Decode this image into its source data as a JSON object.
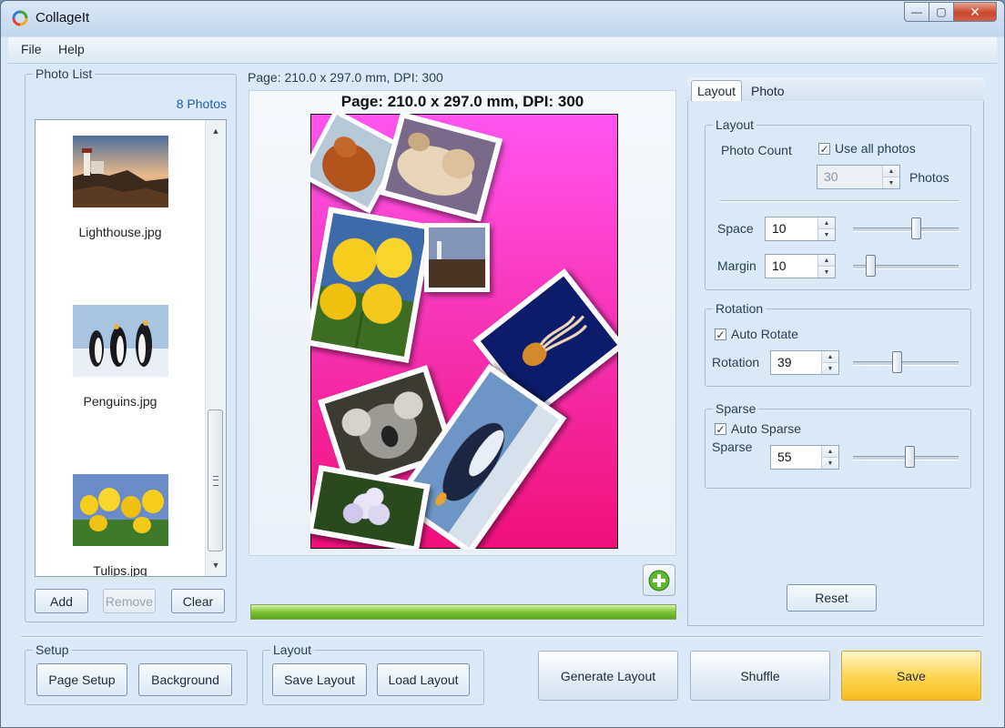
{
  "window": {
    "title": "CollageIt",
    "minimize": "—",
    "maximize": "▢",
    "close": "✕"
  },
  "menu": {
    "file": "File",
    "help": "Help"
  },
  "photo_list": {
    "title": "Photo List",
    "count": "8 Photos",
    "items": [
      {
        "name": "Lighthouse.jpg",
        "thumb": "lighthouse"
      },
      {
        "name": "Penguins.jpg",
        "thumb": "penguins"
      },
      {
        "name": "Tulips.jpg",
        "thumb": "tulips"
      }
    ],
    "add": "Add",
    "remove": "Remove",
    "clear": "Clear"
  },
  "preview": {
    "page_info": "Page: 210.0 x 297.0 mm, DPI: 300",
    "page_title": "Page: 210.0 x 297.0 mm, DPI: 300",
    "background_colors": [
      "#ff55ee",
      "#f0107a"
    ],
    "progress": 1.0
  },
  "tabs": {
    "layout": "Layout",
    "photo": "Photo",
    "active": "Layout"
  },
  "layout_group": {
    "title": "Layout",
    "photo_count_label": "Photo Count",
    "use_all_label": "Use all photos",
    "use_all_checked": true,
    "photo_count_value": "30",
    "photos_unit": "Photos",
    "space_label": "Space",
    "space_value": "10",
    "space_level": 0.6,
    "margin_label": "Margin",
    "margin_value": "10",
    "margin_level": 0.16
  },
  "rotation_group": {
    "title": "Rotation",
    "auto_label": "Auto Rotate",
    "auto_checked": true,
    "rotation_label": "Rotation",
    "rotation_value": "39",
    "rotation_level": 0.43
  },
  "sparse_group": {
    "title": "Sparse",
    "auto_label": "Auto Sparse",
    "auto_checked": true,
    "sparse_label": "Sparse",
    "sparse_value": "55",
    "sparse_level": 0.55
  },
  "reset": "Reset",
  "setup_group": {
    "title": "Setup",
    "page_setup": "Page Setup",
    "background": "Background"
  },
  "layout_buttons": {
    "title": "Layout",
    "save_layout": "Save Layout",
    "load_layout": "Load Layout"
  },
  "actions": {
    "generate": "Generate Layout",
    "shuffle": "Shuffle",
    "save": "Save"
  }
}
